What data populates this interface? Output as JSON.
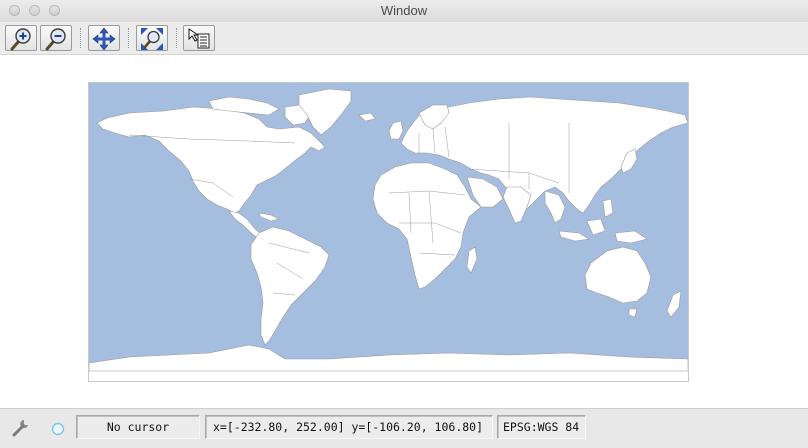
{
  "window": {
    "title": "Window"
  },
  "toolbar": {
    "buttons": [
      {
        "icon": "zoom-in-icon",
        "tooltip": ""
      },
      {
        "icon": "zoom-out-icon",
        "tooltip": ""
      },
      {
        "icon": "pan-icon",
        "tooltip": ""
      },
      {
        "icon": "zoom-extent-icon",
        "tooltip": ""
      },
      {
        "icon": "info-select-icon",
        "tooltip": ""
      }
    ]
  },
  "map": {
    "ocean_color": "#a5bddf",
    "land_color": "#ffffff",
    "border_color": "#9a9a9a"
  },
  "statusbar": {
    "cursor_text": "No cursor",
    "extent_text": "x=[-232.80, 252.00] y=[-106.20, 106.80]",
    "crs_text": "EPSG:WGS 84"
  }
}
